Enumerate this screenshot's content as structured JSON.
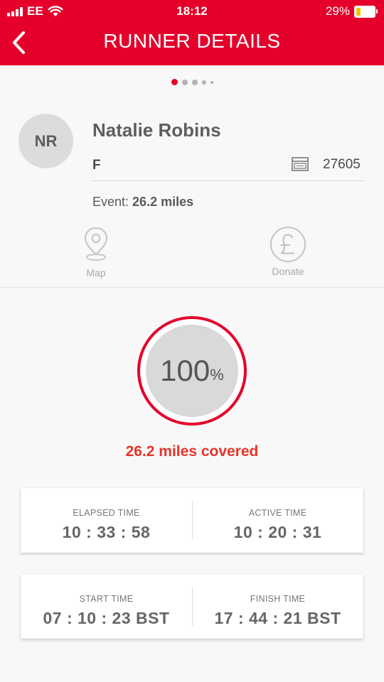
{
  "status_bar": {
    "carrier": "EE",
    "time": "18:12",
    "battery_percent_text": "29%",
    "battery_level": 0.29,
    "battery_fill_color": "#f5c400"
  },
  "nav": {
    "back_icon": "chevron-left-icon",
    "title": "RUNNER DETAILS"
  },
  "pager": {
    "page_count": 5,
    "active_index": 0,
    "active_color": "#e4002b",
    "inactive_color": "#b3b3b3"
  },
  "runner": {
    "initials": "NR",
    "name": "Natalie Robins",
    "gender": "F",
    "bib_icon": "bib-icon",
    "bib_number": "27605",
    "event_label": "Event:",
    "event_value": "26.2 miles"
  },
  "actions": {
    "map": {
      "icon": "map-pin-icon",
      "label": "Map"
    },
    "donate": {
      "icon": "pound-icon",
      "label": "Donate"
    }
  },
  "progress": {
    "percent_value": "100",
    "percent_sign": "%",
    "percent": 100,
    "covered_text": "26.2 miles covered",
    "accent_color": "#e4002b",
    "covered_color": "#e8332a"
  },
  "stats": {
    "elapsed": {
      "label": "ELAPSED TIME",
      "value": "10 : 33 : 58"
    },
    "active": {
      "label": "ACTIVE TIME",
      "value": "10 : 20 : 31"
    },
    "start": {
      "label": "START TIME",
      "value": "07 : 10 : 23 BST"
    },
    "finish": {
      "label": "FINISH TIME",
      "value": "17 : 44 : 21 BST"
    }
  },
  "colors": {
    "header": "#e4002b",
    "background": "#f8f8f8"
  }
}
